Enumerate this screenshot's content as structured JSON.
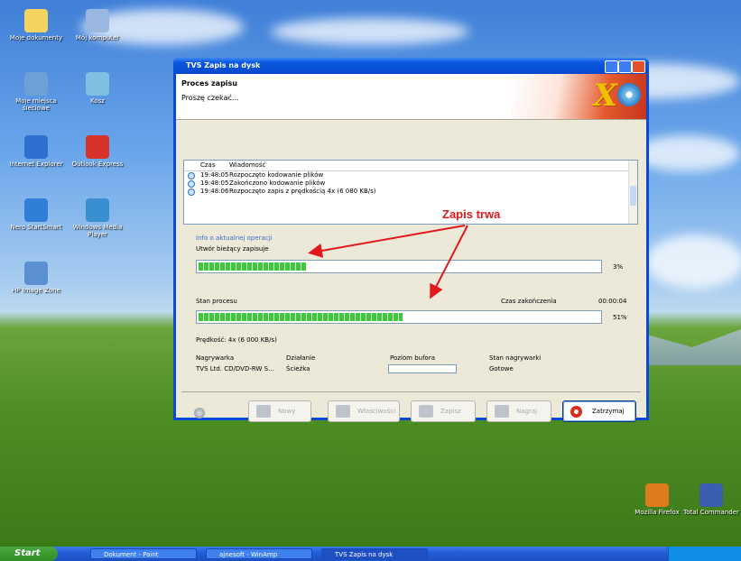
{
  "desktop": {
    "icons_left": [
      {
        "label": "Moje dokumenty",
        "color": "#f4d35e"
      },
      {
        "label": "Mój komputer",
        "color": "#9ab7e0"
      },
      {
        "label": "Moje miejsca sieciowe",
        "color": "#6da0d8"
      },
      {
        "label": "Kosz",
        "color": "#7fbfe2"
      },
      {
        "label": "Internet Explorer",
        "color": "#2f6fd0"
      },
      {
        "label": "Outlook Express",
        "color": "#d8332a"
      },
      {
        "label": "Nero StartSmart",
        "color": "#2f7fd8"
      },
      {
        "label": "Windows Media Player",
        "color": "#3a8fd0"
      },
      {
        "label": "HP Image Zone",
        "color": "#5b8fd0"
      }
    ],
    "icons_right": [
      {
        "label": "Mozilla Firefox",
        "color": "#e07a1e"
      },
      {
        "label": "Total Commander",
        "color": "#3a5fb0"
      }
    ]
  },
  "taskbar": {
    "start_label": "Start",
    "tasks": [
      "Dokument - Paint",
      "ajnesoft - WinAmp",
      "TVS Zapis na dysk"
    ]
  },
  "window": {
    "title": "TVS Zapis na dysk",
    "header_title": "Proces zapisu",
    "header_subtitle": "Proszę czekać...",
    "log_columns": [
      "Czas",
      "Wiadomość"
    ],
    "log_rows": [
      {
        "time": "19:48:05",
        "message": "Rozpoczęto kodowanie plików"
      },
      {
        "time": "19:48:05",
        "message": "Zakończono kodowanie plików"
      },
      {
        "time": "19:48:06",
        "message": "Rozpoczęto zapis z prędkością 4x (6 080 KB/s)"
      }
    ],
    "info_link": "Info o aktualnej operacji",
    "current_label": "Utwór bieżący zapisuje",
    "current_progress_label": "3%",
    "current_progress": 0.27,
    "overall_label": "Stan procesu",
    "time_label": "Czas zakończenia",
    "time_value": "00:00:04",
    "overall_progress_label": "51%",
    "overall_progress": 0.51,
    "speed_text": "Prędkość: 4x (6 000 KB/s)",
    "device_columns": [
      "Nagrywarka",
      "Działanie",
      "Poziom bufora",
      "Stan nagrywarki"
    ],
    "device_row": {
      "name": "TVS Ltd. CD/DVD-RW S...",
      "action": "Ścieżka",
      "state": "Gotowe"
    },
    "buttons": {
      "new": "Nowy",
      "properties": "Właściwości",
      "save": "Zapisz",
      "burn": "Nagraj",
      "stop": "Zatrzymaj"
    }
  },
  "annotation": {
    "text": "Zapis trwa",
    "color": "#e2191c"
  }
}
